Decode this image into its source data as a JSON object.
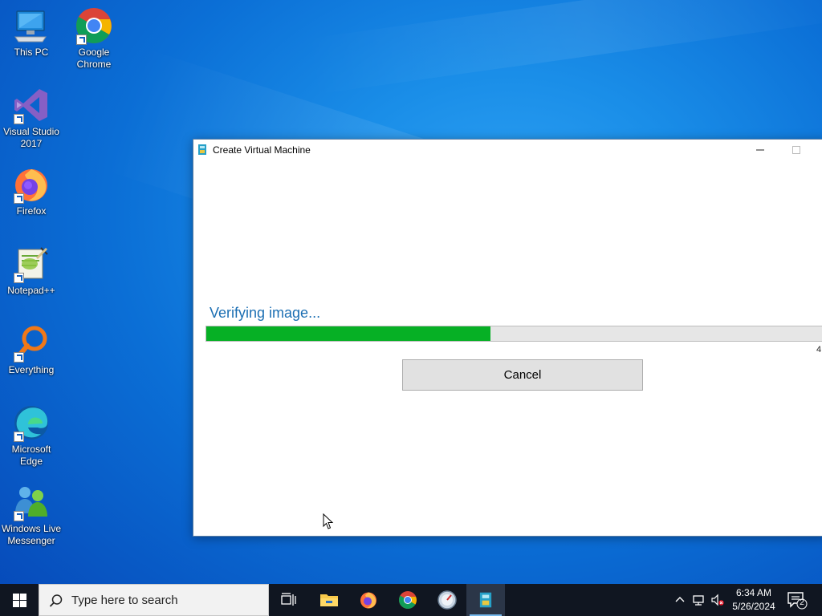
{
  "desktop": {
    "icons": [
      {
        "label": "This PC",
        "icon": "computer-icon"
      },
      {
        "label": "Google Chrome",
        "icon": "chrome-icon"
      },
      {
        "label": "Visual Studio 2017",
        "icon": "visual-studio-icon"
      },
      {
        "label": "Firefox",
        "icon": "firefox-icon"
      },
      {
        "label": "Notepad++",
        "icon": "notepad-plus-plus-icon"
      },
      {
        "label": "Everything",
        "icon": "everything-search-icon"
      },
      {
        "label": "Microsoft Edge",
        "icon": "edge-icon"
      },
      {
        "label": "Windows Live Messenger",
        "icon": "messenger-icon"
      }
    ]
  },
  "window": {
    "title": "Create Virtual Machine",
    "status": "Verifying image...",
    "progress_fraction": 0.455,
    "percent_text": "4",
    "cancel_label": "Cancel"
  },
  "taskbar": {
    "search_placeholder": "Type here to search",
    "apps": [
      "task-view",
      "file-explorer",
      "firefox",
      "chrome",
      "control-panel",
      "create-vm"
    ],
    "time": "6:34 AM",
    "date": "5/26/2024",
    "notification_count": "2"
  },
  "colors": {
    "progress_fill": "#06b025",
    "status_text": "#1c6fb3",
    "taskbar_bg": "#101621"
  }
}
